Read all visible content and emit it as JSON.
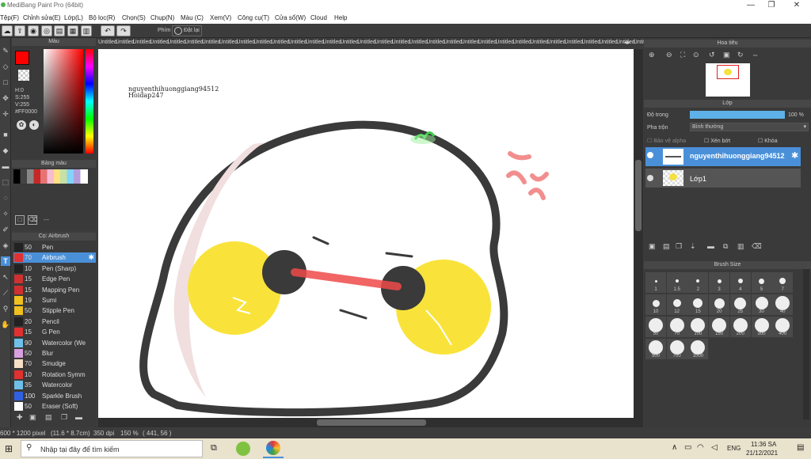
{
  "window": {
    "title": "MediBang Paint Pro (64bit)",
    "min": "—",
    "max": "❐",
    "close": "✕"
  },
  "menu": [
    "Tệp(F)",
    "Chỉnh sửa(E)",
    "Lớp(L)",
    "Bộ lọc(R)",
    "Chọn(S)",
    "Chụp(N)",
    "Màu (C)",
    "Xem(V)",
    "Công cụ(T)",
    "Cửa sổ(W)",
    "Cloud",
    "Help"
  ],
  "toolbar": {
    "snap_label": "Phím",
    "reset_label": "Đặt lại"
  },
  "color_panel": {
    "title": "Màu",
    "h": "H:0",
    "s": "S:255",
    "v": "V:255",
    "hex": "#FF0000",
    "current": "#ff0000"
  },
  "swatch_panel": {
    "title": "Bảng màu",
    "dash": "---"
  },
  "brush_panel": {
    "title": "Cọ: Airbrush",
    "items": [
      {
        "size": "50",
        "name": "Pen",
        "color": "#222222"
      },
      {
        "size": "70",
        "name": "Airbrush",
        "color": "#e03030",
        "selected": true
      },
      {
        "size": "10",
        "name": "Pen (Sharp)",
        "color": "#222222"
      },
      {
        "size": "15",
        "name": "Edge Pen",
        "color": "#d03030"
      },
      {
        "size": "15",
        "name": "Mapping Pen",
        "color": "#d03030"
      },
      {
        "size": "19",
        "name": "Sumi",
        "color": "#f0c020"
      },
      {
        "size": "50",
        "name": "Stipple Pen",
        "color": "#f0c020"
      },
      {
        "size": "20",
        "name": "Pencil",
        "color": "#222222"
      },
      {
        "size": "15",
        "name": "G Pen",
        "color": "#e03030"
      },
      {
        "size": "90",
        "name": "Watercolor (We",
        "color": "#6fc0e8"
      },
      {
        "size": "50",
        "name": "Blur",
        "color": "#d8a0e0"
      },
      {
        "size": "70",
        "name": "Smudge",
        "color": "#f8e0c8"
      },
      {
        "size": "10",
        "name": "Rotation Symm",
        "color": "#e03030"
      },
      {
        "size": "35",
        "name": "Watercolor",
        "color": "#6fc0e8"
      },
      {
        "size": "100",
        "name": "Sparkle Brush",
        "color": "#3060e0"
      },
      {
        "size": "50",
        "name": "Eraser (Soft)",
        "color": "#ffffff"
      }
    ]
  },
  "tabs": [
    "Untitled",
    "Untitled",
    "Untitled",
    "Untitled",
    "Untitled",
    "Untitled",
    "Untitled",
    "Untitled",
    "Untitled",
    "Untitled",
    "Untitled",
    "Untitled",
    "Untitled",
    "Untitled",
    "Untitled",
    "Untitled",
    "Untitled",
    "Untitled",
    "Untitled",
    "Untitled",
    "Untitled",
    "Untitled",
    "Untitled",
    "Untitled",
    "Untitled",
    "Untitled",
    "Untitled",
    "Untitled",
    "Untitled",
    "Untitled",
    "Untitled",
    "Untitled"
  ],
  "canvas": {
    "text1": "nguyenthihuonggiang94512",
    "text2": "Hoidap247"
  },
  "navigator": {
    "title": "Hoa tiêu"
  },
  "layer_panel": {
    "title": "Lớp",
    "opacity_label": "Độ trong",
    "opacity_value": "100 %",
    "opacity": 1.0,
    "blend_label": "Pha trộn",
    "blend_value": "Bình thường",
    "protect_alpha": "Bảo vệ alpha",
    "clipping": "Xén bớt",
    "lock": "Khóa",
    "layers": [
      {
        "name": "nguyenthihuonggiang94512",
        "selected": true
      },
      {
        "name": "Lớp1",
        "selected": false
      }
    ]
  },
  "brush_size": {
    "title": "Brush Size",
    "sizes": [
      "1",
      "1.5",
      "2",
      "3",
      "4",
      "5",
      "7",
      "10",
      "12",
      "15",
      "20",
      "25",
      "30",
      "40",
      "50",
      "70",
      "100",
      "150",
      "200",
      "300",
      "400",
      "500",
      "700",
      "1000"
    ]
  },
  "status": {
    "size": "600 * 1200 pixel",
    "dims": "(11.6 * 8.7cm)",
    "dpi": "350 dpi",
    "zoom": "150 %",
    "coords": "( 441, 56 )"
  },
  "taskbar": {
    "search_placeholder": "Nhập tại đây để tìm kiếm",
    "lang": "ENG",
    "time": "11:36 SA",
    "date": "21/12/2021"
  }
}
